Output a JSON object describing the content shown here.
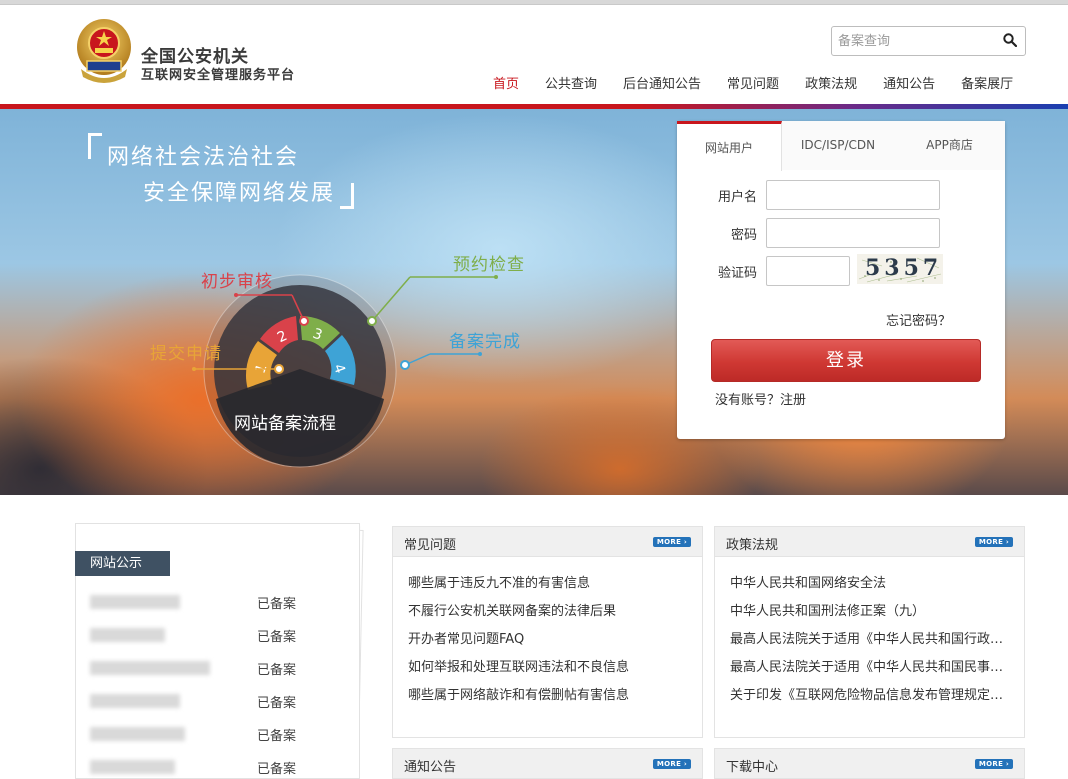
{
  "header": {
    "title": "全国公安机关",
    "subtitle": "互联网安全管理服务平台",
    "search_placeholder": "备案查询"
  },
  "nav": {
    "items": [
      {
        "label": "首页",
        "active": true
      },
      {
        "label": "公共查询",
        "active": false
      },
      {
        "label": "后台通知公告",
        "active": false
      },
      {
        "label": "常见问题",
        "active": false
      },
      {
        "label": "政策法规",
        "active": false
      },
      {
        "label": "通知公告",
        "active": false
      },
      {
        "label": "备案展厅",
        "active": false
      }
    ]
  },
  "banner": {
    "slogan_line1": "网络社会法治社会",
    "slogan_line2": "安全保障网络发展",
    "flow_title": "网站备案流程",
    "steps": [
      {
        "num": "1",
        "label": "提交申请",
        "color": "#e8a437"
      },
      {
        "num": "2",
        "label": "初步审核",
        "color": "#d9424a"
      },
      {
        "num": "3",
        "label": "预约检查",
        "color": "#7fae4a"
      },
      {
        "num": "4",
        "label": "备案完成",
        "color": "#3ea3d6"
      }
    ]
  },
  "login": {
    "tabs": [
      "网站用户",
      "IDC/ISP/CDN",
      "APP商店"
    ],
    "username_label": "用户名",
    "password_label": "密码",
    "captcha_label": "验证码",
    "captcha_text": "5357",
    "forgot": "忘记密码？",
    "login_button": "登录",
    "register": "没有账号？注册"
  },
  "public_notice": {
    "title": "网站公示",
    "rows": [
      {
        "status": "已备案"
      },
      {
        "status": "已备案"
      },
      {
        "status": "已备案"
      },
      {
        "status": "已备案"
      },
      {
        "status": "已备案"
      },
      {
        "status": "已备案"
      }
    ]
  },
  "cards": {
    "faq": {
      "title": "常见问题",
      "more": "MORE",
      "items": [
        "哪些属于违反九不准的有害信息",
        "不履行公安机关联网备案的法律后果",
        "开办者常见问题FAQ",
        "如何举报和处理互联网违法和不良信息",
        "哪些属于网络敲诈和有偿删帖有害信息"
      ]
    },
    "policy": {
      "title": "政策法规",
      "more": "MORE",
      "items": [
        "中华人民共和国网络安全法",
        "中华人民共和国刑法修正案（九）",
        "最高人民法院关于适用《中华人民共和国行政诉讼法》的解释",
        "最高人民法院关于适用《中华人民共和国民事诉讼法》的解释",
        "关于印发《互联网危险物品信息发布管理规定》的通知"
      ]
    },
    "notice": {
      "title": "通知公告",
      "more": "MORE"
    },
    "download": {
      "title": "下载中心",
      "more": "MORE"
    }
  },
  "colors": {
    "brand_red": "#c8161d",
    "brand_blue": "#1a3fb0",
    "more_badge": "#2472b9"
  }
}
